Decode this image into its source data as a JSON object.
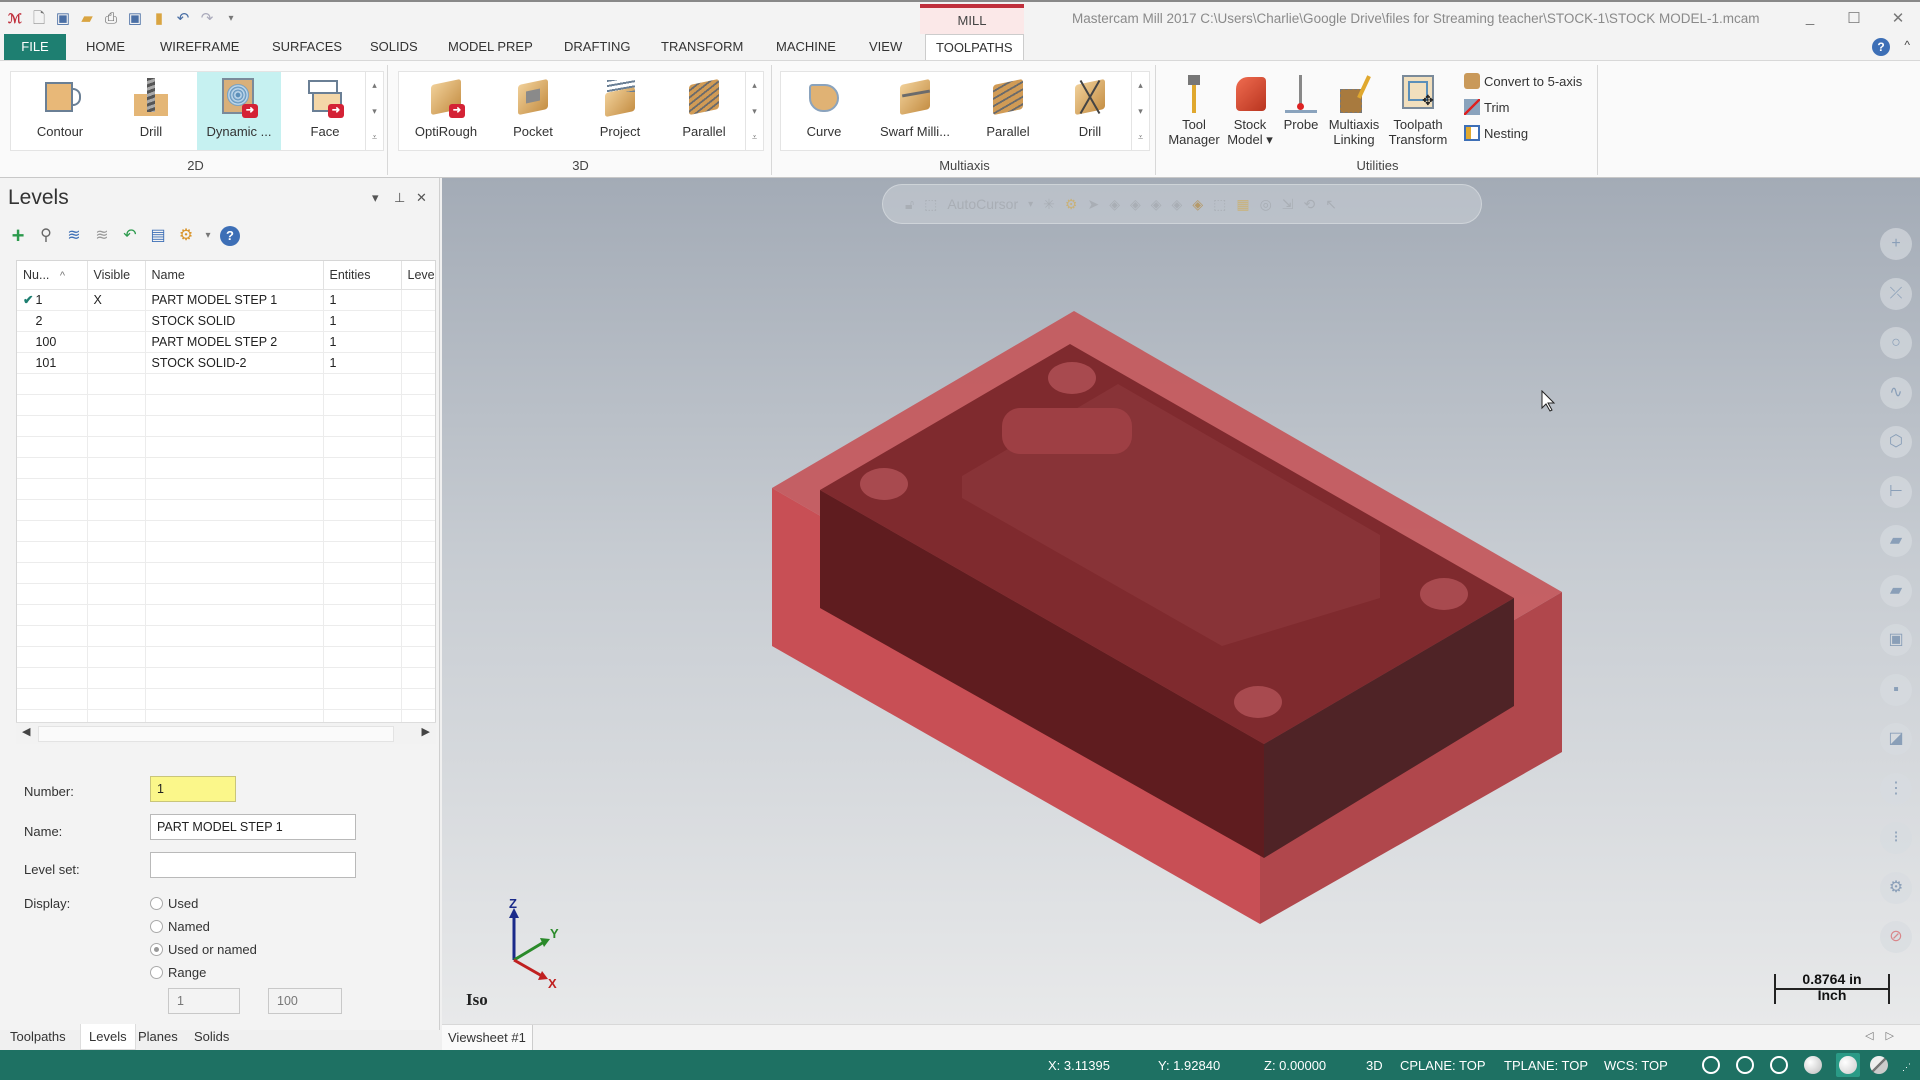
{
  "titlebar": {
    "context_tab": "MILL",
    "app_title": "Mastercam Mill 2017  C:\\Users\\Charlie\\Google Drive\\files for Streaming teacher\\STOCK-1\\STOCK MODEL-1.mcam",
    "quick_access": [
      "app-logo",
      "new-file-icon",
      "save-icon",
      "open-icon",
      "print-icon",
      "save-as-icon",
      "merge-icon",
      "undo-icon",
      "redo-icon",
      "customize-icon"
    ],
    "window_controls": {
      "minimize": "_",
      "maximize": "☐",
      "close": "✕"
    }
  },
  "ribbon_tabs": [
    {
      "label": "FILE"
    },
    {
      "label": "HOME"
    },
    {
      "label": "WIREFRAME"
    },
    {
      "label": "SURFACES"
    },
    {
      "label": "SOLIDS"
    },
    {
      "label": "MODEL PREP"
    },
    {
      "label": "DRAFTING"
    },
    {
      "label": "TRANSFORM"
    },
    {
      "label": "MACHINE"
    },
    {
      "label": "VIEW"
    },
    {
      "label": "TOOLPATHS",
      "active": true
    }
  ],
  "ribbon": {
    "groups": {
      "g2d": {
        "label": "2D",
        "buttons": [
          "Contour",
          "Drill",
          "Dynamic ...",
          "Face"
        ],
        "selected": "Dynamic ..."
      },
      "g3d": {
        "label": "3D",
        "buttons": [
          "OptiRough",
          "Pocket",
          "Project",
          "Parallel"
        ]
      },
      "multiaxis": {
        "label": "Multiaxis",
        "buttons": [
          "Curve",
          "Swarf Milli...",
          "Parallel",
          "Drill"
        ]
      },
      "utilities": {
        "label": "Utilities",
        "buttons": [
          {
            "line1": "Tool",
            "line2": "Manager"
          },
          {
            "line1": "Stock",
            "line2": "Model ▾"
          },
          {
            "line1": "Probe",
            "line2": ""
          },
          {
            "line1": "Multiaxis",
            "line2": "Linking"
          },
          {
            "line1": "Toolpath",
            "line2": "Transform"
          }
        ],
        "small_buttons": [
          "Convert to 5-axis",
          "Trim",
          "Nesting"
        ]
      }
    },
    "help_icon": "?",
    "collapse_icon": "^"
  },
  "levels_panel": {
    "title": "Levels",
    "controls": {
      "dropdown": "▾",
      "pin": "⊥",
      "close": "✕"
    },
    "toolbar_icons": [
      "add-level-icon",
      "find-icon",
      "make-visible-icon",
      "hide-icon",
      "undo-icon",
      "properties-icon",
      "settings-icon",
      "help-icon"
    ],
    "columns": [
      "Nu...",
      "Visible",
      "Name",
      "Entities",
      "Level"
    ],
    "sort_indicator": "^",
    "rows": [
      {
        "number": "1",
        "visible": "X",
        "name": "PART MODEL STEP 1",
        "entities": "1",
        "level": "",
        "active": true
      },
      {
        "number": "2",
        "visible": "",
        "name": "STOCK SOLID",
        "entities": "1",
        "level": "",
        "active": false
      },
      {
        "number": "100",
        "visible": "",
        "name": "PART MODEL STEP 2",
        "entities": "1",
        "level": "",
        "active": false
      },
      {
        "number": "101",
        "visible": "",
        "name": "STOCK SOLID-2",
        "entities": "1",
        "level": "",
        "active": false
      }
    ],
    "form": {
      "number_label": "Number:",
      "number_value": "1",
      "name_label": "Name:",
      "name_value": "PART MODEL STEP 1",
      "level_set_label": "Level set:",
      "level_set_value": "",
      "display_label": "Display:",
      "display_options": [
        {
          "label": "Used",
          "selected": false
        },
        {
          "label": "Named",
          "selected": false
        },
        {
          "label": "Used or named",
          "selected": true
        },
        {
          "label": "Range",
          "selected": false
        }
      ],
      "range_from": "1",
      "range_to": "100"
    },
    "bottom_tabs": [
      {
        "label": "Toolpaths",
        "active": false
      },
      {
        "label": "Levels",
        "active": true
      },
      {
        "label": "Planes",
        "active": false
      },
      {
        "label": "Solids",
        "active": false
      }
    ]
  },
  "viewport": {
    "autocursor_label": "AutoCursor",
    "view_name": "Iso",
    "axes": {
      "x": "X",
      "y": "Y",
      "z": "Z"
    },
    "scale_value": "0.8764 in",
    "scale_unit": "Inch",
    "right_toolbar_icons": [
      "point-icon",
      "line-icon",
      "circle-icon",
      "spline-icon",
      "cube-icon",
      "dimension-icon",
      "surface-icon",
      "surface-alt-icon",
      "solid-icon",
      "box-solid-icon",
      "transform-icon",
      "levels-list-icon",
      "grid-icon",
      "gear-icon",
      "no-entry-icon"
    ],
    "model_colors": {
      "stock": "#c84f55",
      "part": "#7a2226"
    }
  },
  "viewsheet": {
    "tab_label": "Viewsheet #1"
  },
  "statusbar": {
    "x": "X:  3.11395",
    "y": "Y:  1.92840",
    "z": "Z:  0.00000",
    "mode": "3D",
    "cplane": "CPLANE: TOP",
    "tplane": "TPLANE: TOP",
    "wcs": "WCS: TOP",
    "accent": "#1e7163"
  }
}
